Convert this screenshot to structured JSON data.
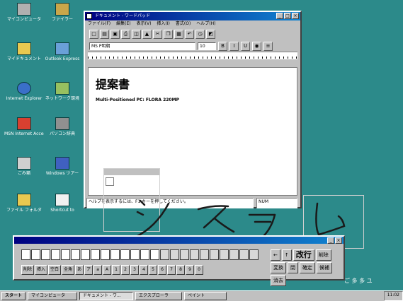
{
  "colors": {
    "desktop": "#2c8a8a",
    "title_active": "#000080",
    "ink": "#1a1a1a"
  },
  "desktop_icons": [
    {
      "label": "マイコンピュータ",
      "icon": "computer-icon"
    },
    {
      "label": "ファイラー",
      "icon": "briefcase-icon"
    },
    {
      "label": "マイドキュメント",
      "icon": "folder-icon"
    },
    {
      "label": "Outlook Express",
      "icon": "mail-icon"
    },
    {
      "label": "Internet Explorer",
      "icon": "globe-icon"
    },
    {
      "label": "ネットワーク環境",
      "icon": "network-icon"
    },
    {
      "label": "MSN Internet Access",
      "icon": "msn-icon"
    },
    {
      "label": "パソコン辞典",
      "icon": "device-icon"
    },
    {
      "label": "ごみ箱",
      "icon": "recycle-bin-icon"
    },
    {
      "label": "Windows ツアー",
      "icon": "pen-icon"
    },
    {
      "label": "ファイル フォルダ",
      "icon": "folder-icon"
    },
    {
      "label": "Shortcut to",
      "icon": "document-icon"
    }
  ],
  "word_window": {
    "title": "ドキュメント - ワードパッド",
    "menus": [
      "ファイル(F)",
      "編集(E)",
      "表示(V)",
      "挿入(I)",
      "書式(O)",
      "ヘルプ(H)"
    ],
    "font_name": "MS P明朝",
    "font_size": "10",
    "doc_title": "提案書",
    "doc_subtitle": "Multi-Positioned PC: FLORA 220MP",
    "status_text": "ヘルプを表示するには、F1 キーを押してください。",
    "status_mode": "NUM"
  },
  "handwriting": "システム",
  "pad": {
    "big_label": "改行",
    "side_buttons": [
      "削除",
      "変換",
      "閉",
      "確定",
      "候補",
      "消去"
    ],
    "keys": [
      "削除",
      "挿入",
      "空白",
      "全角",
      "あ",
      "ア",
      "a",
      "A",
      "1",
      "2",
      "3",
      "4",
      "5",
      "6",
      "7",
      "8",
      "9",
      "0"
    ]
  },
  "tray_top": "ご 多 多 ユ",
  "taskbar": {
    "start": "スタート",
    "items": [
      "マイコンピュータ",
      "ドキュメント - ワ...",
      "エクスプローラ",
      "ペイント"
    ],
    "clock": "11:02"
  }
}
